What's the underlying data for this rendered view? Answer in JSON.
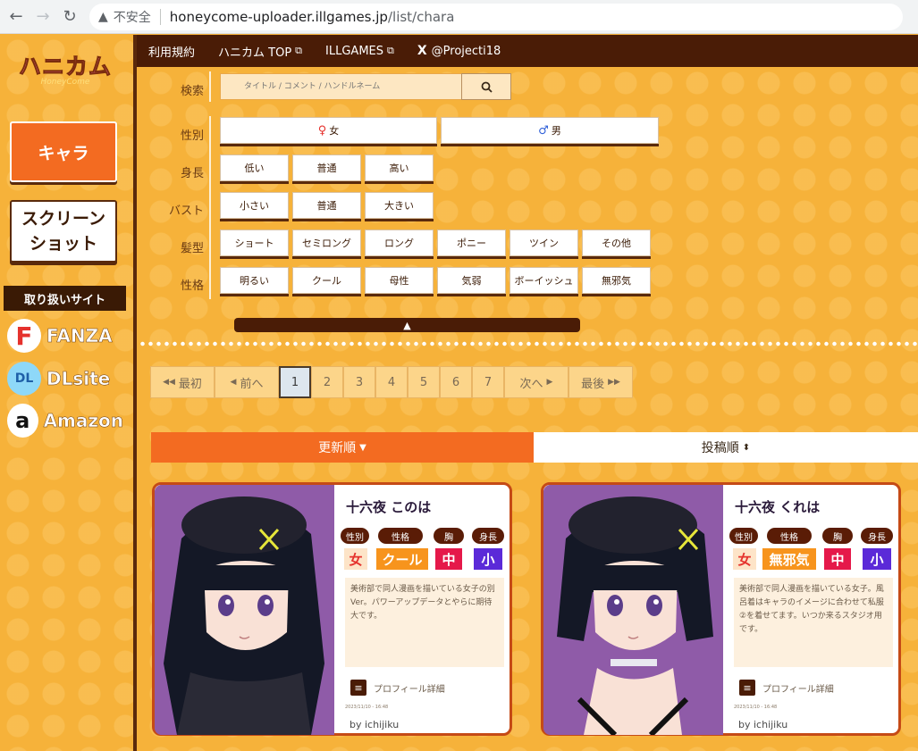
{
  "browser": {
    "insecure_label": "不安全",
    "url_host": "honeycome-uploader.illgames.jp",
    "url_path": "/list/chara"
  },
  "sidebar": {
    "logo_text": "ハニカム",
    "logo_sub": "HoneyCome",
    "chara_label": "キャラ",
    "screenshot_line1": "スクリーン",
    "screenshot_line2": "ショット",
    "sites_header": "取り扱いサイト",
    "sites": [
      {
        "name": "FANZA",
        "icon": "F"
      },
      {
        "name": "DLsite",
        "icon": "DL"
      },
      {
        "name": "Amazon",
        "icon": "a"
      }
    ]
  },
  "topnav": {
    "items": [
      "利用規約",
      "ハニカム TOP",
      "ILLGAMES",
      "@Projecti18"
    ]
  },
  "filters": {
    "search_label": "検索",
    "search_placeholder": "タイトル / コメント / ハンドルネーム",
    "sex_label": "性別",
    "sex_options": [
      "女",
      "男"
    ],
    "height_label": "身長",
    "height_options": [
      "低い",
      "普通",
      "高い"
    ],
    "bust_label": "バスト",
    "bust_options": [
      "小さい",
      "普通",
      "大きい"
    ],
    "hair_label": "髪型",
    "hair_options": [
      "ショート",
      "セミロング",
      "ロング",
      "ポニー",
      "ツイン",
      "その他"
    ],
    "personality_label": "性格",
    "personality_options": [
      "明るい",
      "クール",
      "母性",
      "気弱",
      "ボーイッシュ",
      "無邪気"
    ],
    "collapse_symbol": "▲"
  },
  "pagination": {
    "first": "最初",
    "prev": "前へ",
    "pages": [
      "1",
      "2",
      "3",
      "4",
      "5",
      "6",
      "7"
    ],
    "current": "1",
    "next": "次へ",
    "last": "最後"
  },
  "sort": {
    "newest": "更新順",
    "posted": "投稿順"
  },
  "cards": [
    {
      "name": "十六夜 このは",
      "tags": [
        "性別",
        "性格",
        "胸",
        "身長"
      ],
      "sex": "女",
      "personality": "クール",
      "chest": "中",
      "height": "小",
      "description": "美術部で同人漫画を描いている女子の別Ver。パワーアップデータとやらに期待大です。",
      "profile_link": "プロフィール詳細",
      "date": "2023/11/10 - 16:48",
      "author": "by ichijiku"
    },
    {
      "name": "十六夜 くれは",
      "tags": [
        "性別",
        "性格",
        "胸",
        "身長"
      ],
      "sex": "女",
      "personality": "無邪気",
      "chest": "中",
      "height": "小",
      "description": "美術部で同人漫画を描いている女子。風呂着はキャラのイメージに合わせて私服②を着せてます。いつか来るスタジオ用です。",
      "profile_link": "プロフィール詳細",
      "date": "2023/11/10 - 16:48",
      "author": "by ichijiku"
    }
  ]
}
